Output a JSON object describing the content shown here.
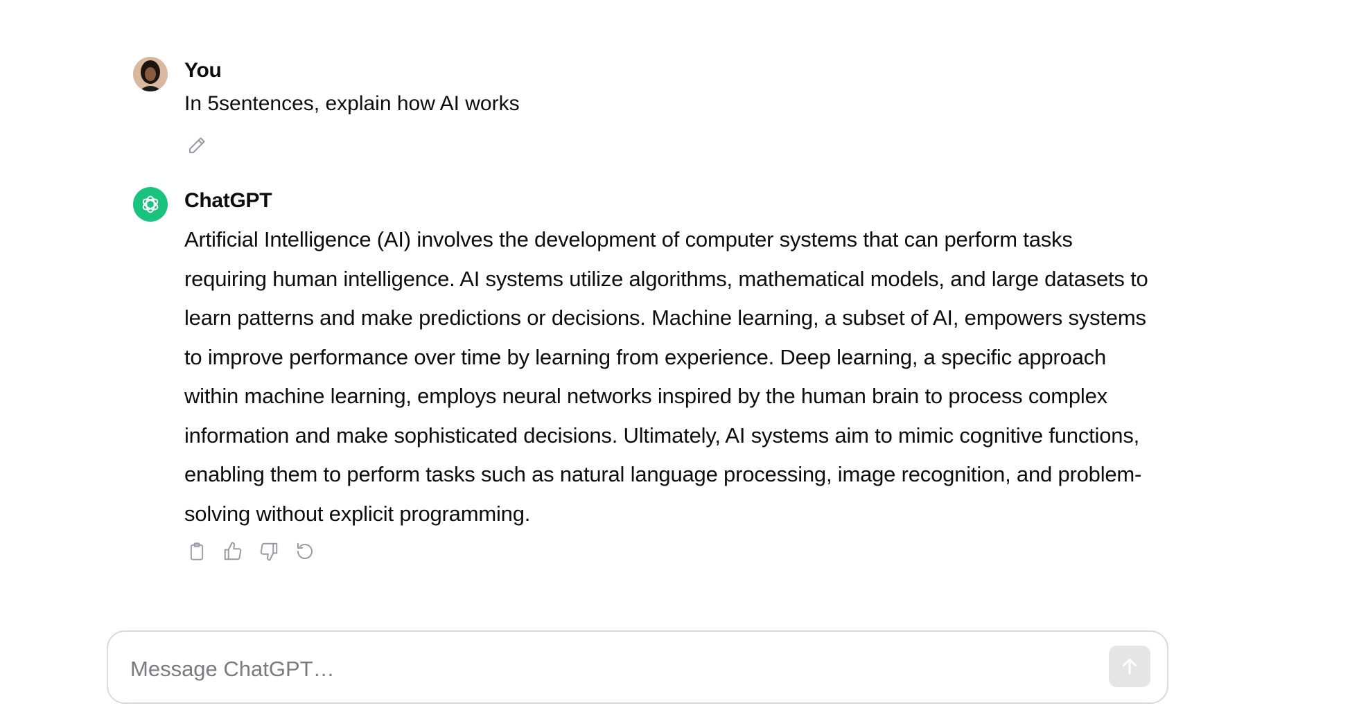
{
  "conversation": {
    "user_message": {
      "author": "You",
      "text": "In 5sentences, explain how AI works",
      "avatar_icon": "user-avatar-photo",
      "edit_icon": "pencil-icon"
    },
    "assistant_message": {
      "author": "ChatGPT",
      "avatar_icon": "openai-logo-icon",
      "avatar_color": "#19c37d",
      "text": "Artificial Intelligence (AI) involves the development of computer systems that can perform tasks requiring human intelligence. AI systems utilize algorithms, mathematical models, and large datasets to learn patterns and make predictions or decisions. Machine learning, a subset of AI, empowers systems to improve performance over time by learning from experience. Deep learning, a specific approach within machine learning, employs neural networks inspired by the human brain to process complex information and make sophisticated decisions. Ultimately, AI systems aim to mimic cognitive functions, enabling them to perform tasks such as natural language processing, image recognition, and problem-solving without explicit programming.",
      "actions": [
        "copy-icon",
        "thumbs-up-icon",
        "thumbs-down-icon",
        "regenerate-icon"
      ]
    }
  },
  "composer": {
    "placeholder": "Message ChatGPT…",
    "value": "",
    "send_icon": "arrow-up-icon"
  },
  "colors": {
    "icon_gray": "#9a9aa6",
    "send_button_bg": "#e5e5e5",
    "border": "#d9d9e3"
  }
}
